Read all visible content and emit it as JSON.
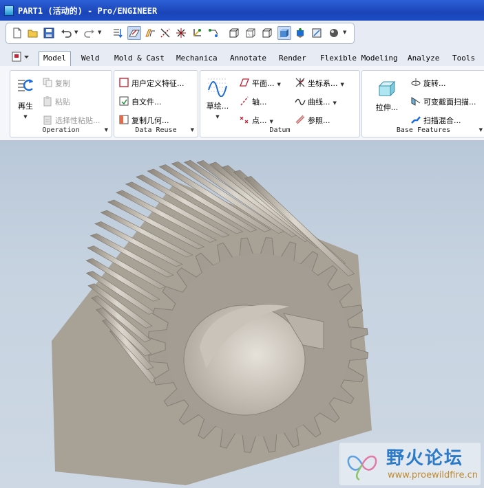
{
  "window": {
    "title": "PART1 (活动的) - Pro/ENGINEER",
    "icon": "part-icon"
  },
  "quick_toolbar": {
    "buttons": [
      "new-icon",
      "open-icon",
      "save-icon",
      "undo-icon",
      "redo-icon",
      "regenerate-icon",
      "sketch-view-icon",
      "datum-planes-icon",
      "datum-axes-icon",
      "datum-points-icon",
      "datum-csys-icon",
      "annotation-icon",
      "wireframe-icon",
      "hidden-line-icon",
      "no-hidden-icon",
      "shading-icon",
      "saved-views-icon",
      "orient-icon",
      "appearance-icon"
    ]
  },
  "tabs": {
    "items": [
      "Model",
      "Weld",
      "Mold & Cast",
      "Mechanica",
      "Annotate",
      "Render",
      "Flexible Modeling",
      "Analyze",
      "Tools"
    ],
    "active": "Model"
  },
  "ribbon": {
    "operation": {
      "label": "Operation",
      "regenerate": "再生",
      "copy": "复制",
      "paste": "粘贴",
      "paste_special": "选择性粘贴..."
    },
    "data_reuse": {
      "label": "Data Reuse",
      "udf": "用户定义特征...",
      "from_file": "自文件...",
      "copy_geometry": "复制几何..."
    },
    "datum": {
      "label": "Datum",
      "sketch": "草绘...",
      "plane": "平面...",
      "axis": "轴...",
      "point": "点...",
      "csys": "坐标系...",
      "curve": "曲线...",
      "reference": "参照..."
    },
    "base_features": {
      "label": "Base Features",
      "extrude": "拉伸...",
      "revolve": "旋转...",
      "variable_sweep": "可变截面扫描...",
      "swept_blend": "扫描混合..."
    }
  },
  "viewport": {
    "model": "helical-gear",
    "background_top": "#b9c8d9",
    "background_bottom": "#cdd8e4",
    "gear_color": "#a39c92"
  },
  "watermark": {
    "title": "野火论坛",
    "url": "www.proewildfire.cn"
  }
}
